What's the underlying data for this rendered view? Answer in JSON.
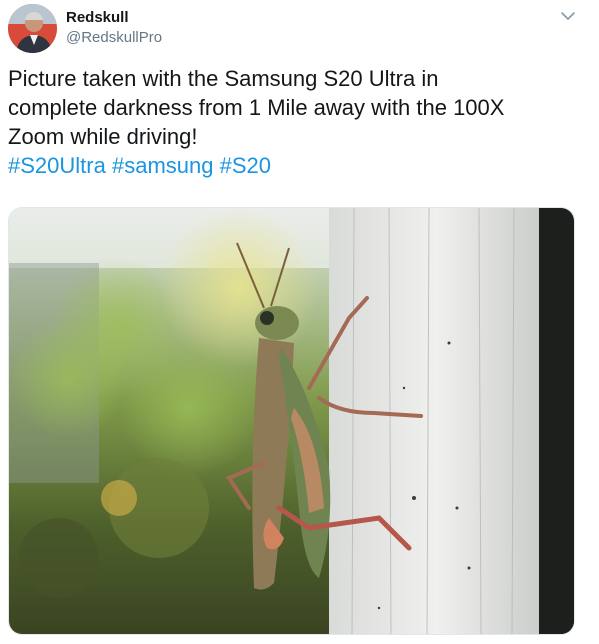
{
  "tweet": {
    "author_name": "Redskull",
    "author_handle": "@RedskullPro",
    "text_lines": [
      "Picture taken with the Samsung S20 Ultra in",
      "complete darkness from 1 Mile away with the 100X",
      "Zoom while driving!"
    ],
    "hashtags": [
      "#S20Ultra",
      "#samsung",
      "#S20"
    ],
    "icons": {
      "menu": "chevron-down-icon",
      "avatar": "avatar-photo"
    },
    "media": {
      "description_icon": "grasshopper-photo"
    }
  },
  "colors": {
    "text": "#14171a",
    "secondary": "#657786",
    "link": "#1b95e0"
  }
}
